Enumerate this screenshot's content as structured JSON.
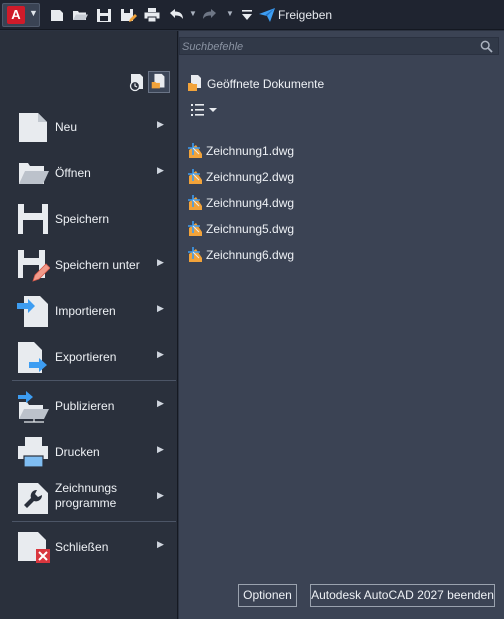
{
  "qat": {
    "app_letter": "A",
    "share_label": "Freigeben",
    "icons": [
      "new-file-icon",
      "open-folder-icon",
      "save-icon",
      "save-as-icon",
      "print-icon",
      "undo-icon",
      "redo-icon",
      "customize-icon",
      "share-icon"
    ]
  },
  "menu": {
    "items": [
      {
        "label": "Neu",
        "icon": "new-document-icon",
        "has_submenu": true
      },
      {
        "label": "Öffnen",
        "icon": "open-folder-icon",
        "has_submenu": true
      },
      {
        "label": "Speichern",
        "icon": "save-icon",
        "has_submenu": false
      },
      {
        "label": "Speichern unter",
        "icon": "save-as-icon",
        "has_submenu": true
      },
      {
        "label": "Importieren",
        "icon": "import-icon",
        "has_submenu": true
      },
      {
        "label": "Exportieren",
        "icon": "export-icon",
        "has_submenu": true
      },
      {
        "label": "Publizieren",
        "icon": "publish-icon",
        "has_submenu": true
      },
      {
        "label": "Drucken",
        "icon": "print-icon",
        "has_submenu": true
      },
      {
        "label_line1": "Zeichnungs",
        "label_line2": "programme",
        "icon": "wrench-icon",
        "has_submenu": true
      },
      {
        "label": "Schließen",
        "icon": "close-document-icon",
        "has_submenu": true
      }
    ]
  },
  "search": {
    "placeholder": "Suchbefehle"
  },
  "recent": {
    "header": "Geöffnete Dokumente",
    "documents": [
      {
        "name": "Zeichnung1.dwg"
      },
      {
        "name": "Zeichnung2.dwg"
      },
      {
        "name": "Zeichnung4.dwg"
      },
      {
        "name": "Zeichnung5.dwg"
      },
      {
        "name": "Zeichnung6.dwg"
      }
    ]
  },
  "footer": {
    "options_label": "Optionen",
    "exit_label": "Autodesk AutoCAD 2027 beenden"
  },
  "colors": {
    "accent": "#3d9df2",
    "brand_red": "#d01b2a",
    "panel_left": "#2a303c",
    "panel_right": "#3b4354"
  }
}
